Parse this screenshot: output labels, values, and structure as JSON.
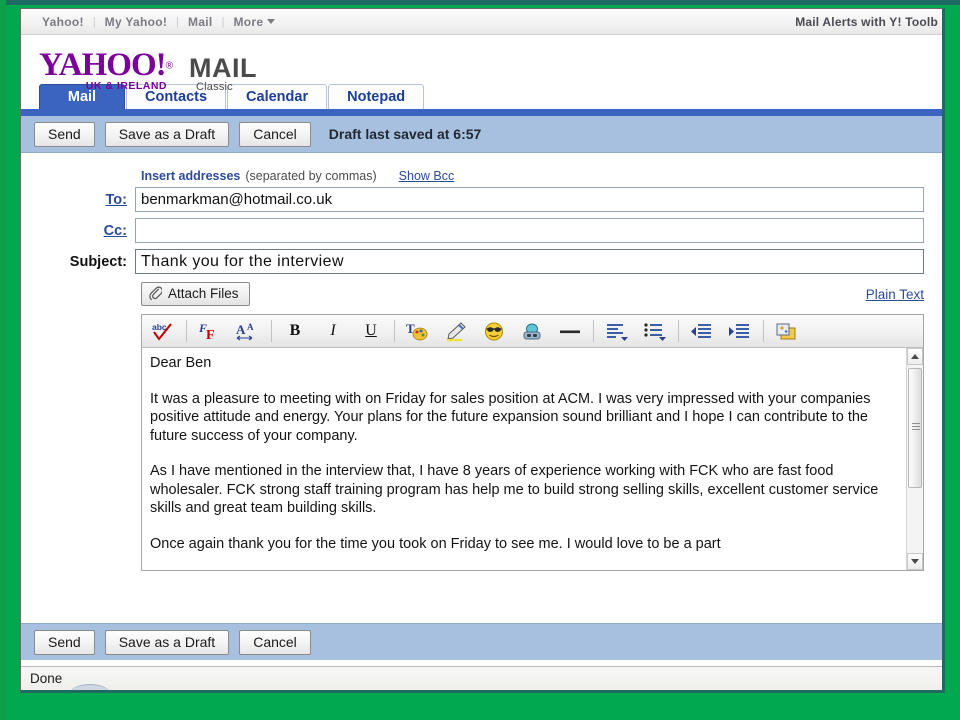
{
  "window": {
    "desktop_color": "#00a94f",
    "edge_color": "#1d6b63"
  },
  "top_nav": {
    "links": [
      {
        "label": "Yahoo!"
      },
      {
        "label": "My Yahoo!"
      },
      {
        "label": "Mail"
      }
    ],
    "separator": "|",
    "more_label": "More",
    "promo_text": "Mail Alerts with Y! Toolb"
  },
  "branding": {
    "yahoo_wordmark": "YAHOO!",
    "yahoo_reg": "®",
    "region": "UK & IRELAND",
    "product": "MAIL",
    "product_sub": "Classic",
    "logo_color": "#7b0099",
    "product_color": "#4b4b4b"
  },
  "tabs": [
    {
      "label": "Mail",
      "active": true
    },
    {
      "label": "Contacts",
      "active": false
    },
    {
      "label": "Calendar",
      "active": false
    },
    {
      "label": "Notepad",
      "active": false
    }
  ],
  "tab_accent_color": "#3a64c0",
  "action_bar": {
    "send_label": "Send",
    "save_draft_label": "Save as a Draft",
    "cancel_label": "Cancel",
    "draft_status": "Draft last saved at 6:57",
    "background_color": "#a8c0e0"
  },
  "compose": {
    "insert_addresses_link": "Insert addresses",
    "insert_hint": "(separated by commas)",
    "show_bcc_link": "Show Bcc",
    "fields": [
      {
        "label": "To:",
        "value": "benmarkman@hotmail.co.uk",
        "placeholder": "",
        "style": "link"
      },
      {
        "label": "Cc:",
        "value": "",
        "placeholder": "",
        "style": "link"
      },
      {
        "label": "Subject:",
        "value": "Thank you for the interview",
        "placeholder": "",
        "style": "plain"
      }
    ],
    "attach_files_label": "Attach Files",
    "attach_icon": "paperclip-icon",
    "plain_text_link": "Plain Text"
  },
  "editor_toolbar": {
    "groups": [
      {
        "buttons": [
          {
            "name": "spellcheck-icon",
            "glyph": "abc",
            "title": "Check Spelling"
          }
        ]
      },
      {
        "buttons": [
          {
            "name": "font-family-icon",
            "glyph": "F",
            "title": "Font"
          },
          {
            "name": "font-size-icon",
            "glyph": "A",
            "title": "Font Size"
          }
        ]
      },
      {
        "buttons": [
          {
            "name": "bold-icon",
            "glyph": "B",
            "title": "Bold"
          },
          {
            "name": "italic-icon",
            "glyph": "I",
            "title": "Italic"
          },
          {
            "name": "underline-icon",
            "glyph": "U",
            "title": "Underline"
          }
        ]
      },
      {
        "buttons": [
          {
            "name": "text-color-icon",
            "glyph": "T",
            "title": "Text Color"
          },
          {
            "name": "highlighter-icon",
            "glyph": "",
            "title": "Highlight"
          },
          {
            "name": "emoticon-icon",
            "glyph": "",
            "title": "Insert Emoticon"
          },
          {
            "name": "insert-link-icon",
            "glyph": "",
            "title": "Insert Link"
          },
          {
            "name": "horizontal-rule-icon",
            "glyph": "—",
            "title": "Horizontal Rule"
          }
        ]
      },
      {
        "buttons": [
          {
            "name": "align-text-icon",
            "glyph": "",
            "title": "Align"
          },
          {
            "name": "bulleted-list-icon",
            "glyph": "",
            "title": "List"
          }
        ]
      },
      {
        "buttons": [
          {
            "name": "outdent-icon",
            "glyph": "",
            "title": "Decrease Indent"
          },
          {
            "name": "indent-icon",
            "glyph": "",
            "title": "Increase Indent"
          }
        ]
      },
      {
        "buttons": [
          {
            "name": "stationery-icon",
            "glyph": "",
            "title": "Stationery"
          }
        ]
      }
    ]
  },
  "message_body": {
    "paragraphs": [
      "Dear Ben",
      "It was a pleasure to meeting with on Friday for sales position at ACM. I was very impressed with your companies positive attitude and energy. Your plans for the future expansion sound brilliant and I hope I can contribute to the future success of your company.",
      "As I have mentioned in the interview that, I have 8 years of experience working with FCK who are fast food wholesaler. FCK strong staff training program has help me to build strong selling skills, excellent customer service skills and great team building skills.",
      "Once again thank you for the time you took on Friday to see me. I would love to be a part"
    ]
  },
  "status_bar": {
    "text": "Done"
  }
}
